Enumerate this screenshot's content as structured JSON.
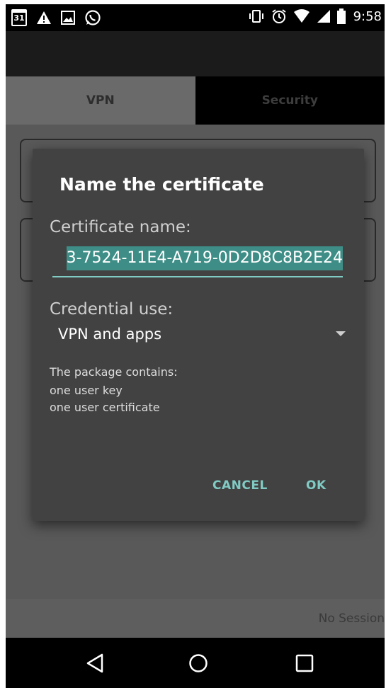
{
  "status_bar": {
    "calendar_day": "31",
    "time": "9:58",
    "left_icons": [
      "calendar-icon",
      "warning-icon",
      "image-icon",
      "whatsapp-icon"
    ],
    "right_icons": [
      "vibrate-icon",
      "alarm-icon",
      "wifi-icon",
      "signal-icon",
      "battery-icon"
    ]
  },
  "tabs": {
    "vpn": "VPN",
    "security": "Security"
  },
  "dialog": {
    "title": "Name the certificate",
    "cert_label": "Certificate name:",
    "cert_value": "3-7524-11E4-A719-0D2D8C8B2E24",
    "credential_label": "Credential use:",
    "credential_value": "VPN and apps",
    "package_label": "The package contains:",
    "package_items": [
      "one user key",
      "one user certificate"
    ],
    "cancel": "CANCEL",
    "ok": "OK"
  },
  "footer": {
    "session_status": "No Session"
  },
  "colors": {
    "accent": "#80cbc4",
    "dialog_bg": "#424242",
    "selection": "#3e8e87"
  }
}
